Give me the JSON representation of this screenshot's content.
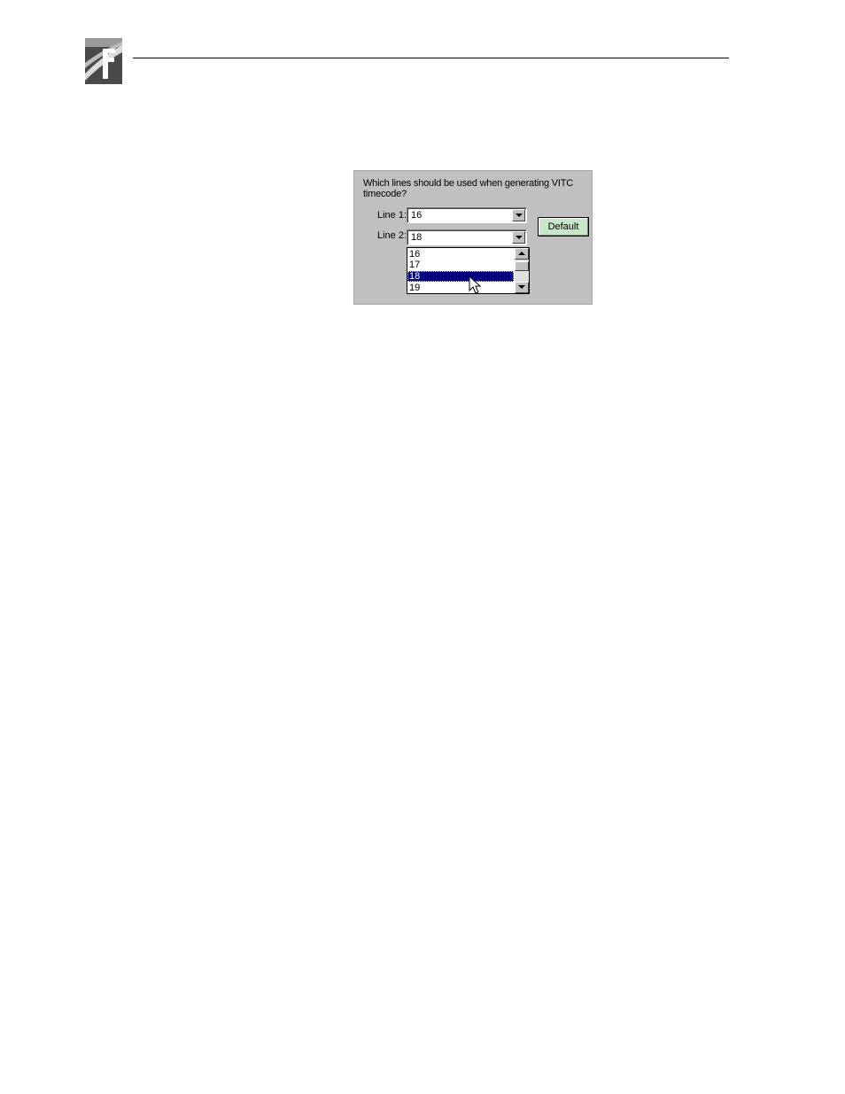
{
  "dialog": {
    "question": "Which lines should be used when generating VITC timecode?",
    "line1": {
      "label": "Line 1:",
      "value": "16"
    },
    "line2": {
      "label": "Line 2:",
      "value": "18"
    },
    "line2_options": [
      "16",
      "17",
      "18",
      "19"
    ],
    "line2_highlighted": "18",
    "default_button": "Default"
  },
  "colors": {
    "dialog_background": "#c0c0c0",
    "selection": "#000080",
    "default_button": "#c8e6c8"
  }
}
